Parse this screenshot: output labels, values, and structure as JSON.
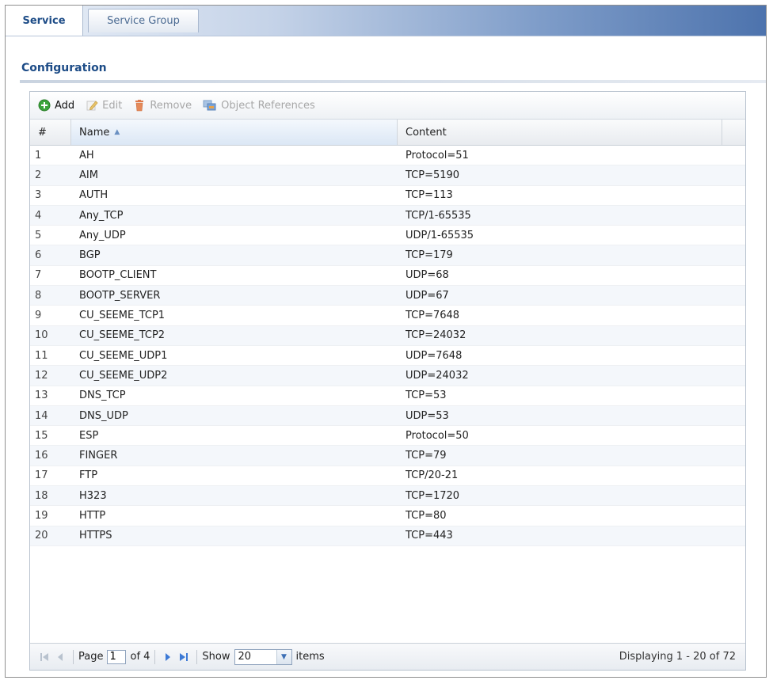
{
  "tabs": [
    {
      "label": "Service",
      "active": true
    },
    {
      "label": "Service Group",
      "active": false
    }
  ],
  "section": {
    "title": "Configuration"
  },
  "toolbar": {
    "add": "Add",
    "edit": "Edit",
    "remove": "Remove",
    "object_references": "Object References"
  },
  "table": {
    "headers": {
      "num": "#",
      "name": "Name",
      "content": "Content"
    },
    "sort": {
      "column": "name",
      "direction": "ascending"
    },
    "rows": [
      {
        "num": "1",
        "name": "AH",
        "content": "Protocol=51"
      },
      {
        "num": "2",
        "name": "AIM",
        "content": "TCP=5190"
      },
      {
        "num": "3",
        "name": "AUTH",
        "content": "TCP=113"
      },
      {
        "num": "4",
        "name": "Any_TCP",
        "content": "TCP/1-65535"
      },
      {
        "num": "5",
        "name": "Any_UDP",
        "content": "UDP/1-65535"
      },
      {
        "num": "6",
        "name": "BGP",
        "content": "TCP=179"
      },
      {
        "num": "7",
        "name": "BOOTP_CLIENT",
        "content": "UDP=68"
      },
      {
        "num": "8",
        "name": "BOOTP_SERVER",
        "content": "UDP=67"
      },
      {
        "num": "9",
        "name": "CU_SEEME_TCP1",
        "content": "TCP=7648"
      },
      {
        "num": "10",
        "name": "CU_SEEME_TCP2",
        "content": "TCP=24032"
      },
      {
        "num": "11",
        "name": "CU_SEEME_UDP1",
        "content": "UDP=7648"
      },
      {
        "num": "12",
        "name": "CU_SEEME_UDP2",
        "content": "UDP=24032"
      },
      {
        "num": "13",
        "name": "DNS_TCP",
        "content": "TCP=53"
      },
      {
        "num": "14",
        "name": "DNS_UDP",
        "content": "UDP=53"
      },
      {
        "num": "15",
        "name": "ESP",
        "content": "Protocol=50"
      },
      {
        "num": "16",
        "name": "FINGER",
        "content": "TCP=79"
      },
      {
        "num": "17",
        "name": "FTP",
        "content": "TCP/20-21"
      },
      {
        "num": "18",
        "name": "H323",
        "content": "TCP=1720"
      },
      {
        "num": "19",
        "name": "HTTP",
        "content": "TCP=80"
      },
      {
        "num": "20",
        "name": "HTTPS",
        "content": "TCP=443"
      }
    ]
  },
  "pager": {
    "page_label": "Page",
    "page_value": "1",
    "of_label": "of 4",
    "show_label": "Show",
    "show_value": "20",
    "items_label": "items",
    "display_text": "Displaying 1 - 20 of 72"
  },
  "colors": {
    "accent": "#1d4c87",
    "add_icon": "#3aa43a",
    "remove_icon": "#e07a4a"
  }
}
